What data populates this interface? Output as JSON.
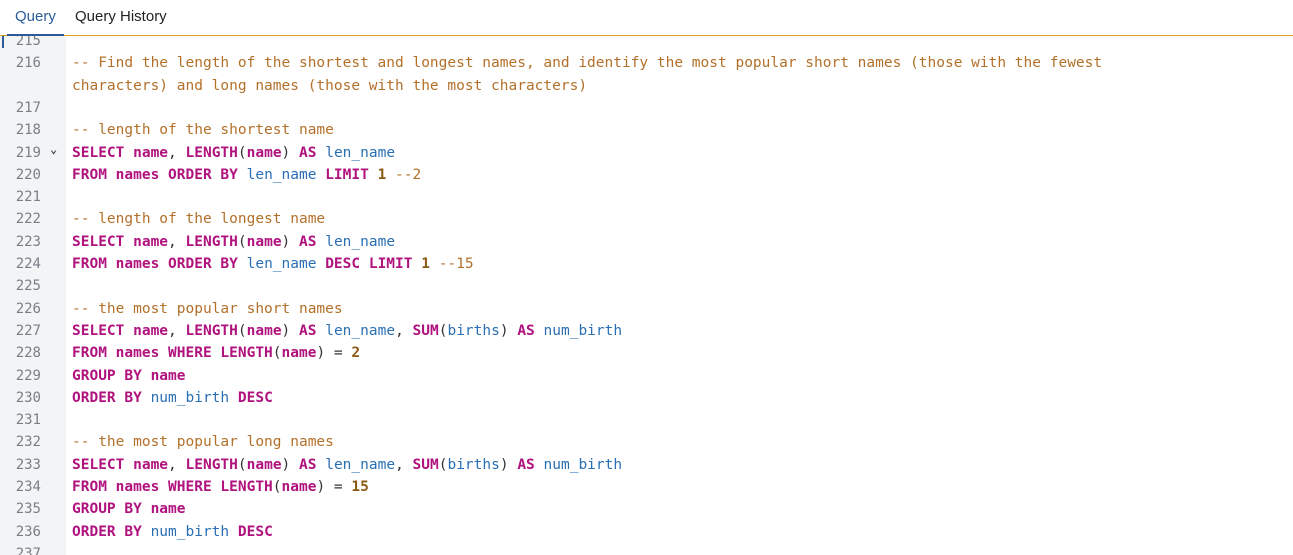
{
  "tabs": [
    {
      "label": "Query",
      "active": true
    },
    {
      "label": "Query History",
      "active": false
    }
  ],
  "colors": {
    "keyword": "#b0127e",
    "comment": "#b3702a",
    "identifier": "#2a6fb3",
    "number": "#8a5a12",
    "tab_active": "#2b5b9b",
    "divider": "#d6a21d"
  },
  "editor": {
    "fold_icon": "chevron-down-icon",
    "lines": [
      {
        "num": "215",
        "tokens": []
      },
      {
        "num": "216",
        "tokens": [
          {
            "t": "cm",
            "v": "-- Find the length of the shortest and longest names, and identify the most popular short names (those with the fewest"
          }
        ]
      },
      {
        "num": "",
        "tokens": [
          {
            "t": "cm",
            "v": "characters) and long names (those with the most characters)"
          }
        ]
      },
      {
        "num": "217",
        "tokens": []
      },
      {
        "num": "218",
        "tokens": [
          {
            "t": "cm",
            "v": "-- length of the shortest name"
          }
        ]
      },
      {
        "num": "219",
        "fold": true,
        "tokens": [
          {
            "t": "kw",
            "v": "SELECT name"
          },
          {
            "t": "tx",
            "v": ", "
          },
          {
            "t": "kw",
            "v": "LENGTH"
          },
          {
            "t": "tx",
            "v": "("
          },
          {
            "t": "kw",
            "v": "name"
          },
          {
            "t": "tx",
            "v": ") "
          },
          {
            "t": "kw",
            "v": "AS"
          },
          {
            "t": "tx",
            "v": " "
          },
          {
            "t": "id",
            "v": "len_name"
          }
        ]
      },
      {
        "num": "220",
        "tokens": [
          {
            "t": "kw",
            "v": "FROM names ORDER BY"
          },
          {
            "t": "tx",
            "v": " "
          },
          {
            "t": "id",
            "v": "len_name"
          },
          {
            "t": "tx",
            "v": " "
          },
          {
            "t": "kw",
            "v": "LIMIT"
          },
          {
            "t": "tx",
            "v": " "
          },
          {
            "t": "num",
            "v": "1"
          },
          {
            "t": "tx",
            "v": " "
          },
          {
            "t": "cm",
            "v": "--2"
          }
        ]
      },
      {
        "num": "221",
        "tokens": []
      },
      {
        "num": "222",
        "tokens": [
          {
            "t": "cm",
            "v": "-- length of the longest name"
          }
        ]
      },
      {
        "num": "223",
        "tokens": [
          {
            "t": "kw",
            "v": "SELECT name"
          },
          {
            "t": "tx",
            "v": ", "
          },
          {
            "t": "kw",
            "v": "LENGTH"
          },
          {
            "t": "tx",
            "v": "("
          },
          {
            "t": "kw",
            "v": "name"
          },
          {
            "t": "tx",
            "v": ") "
          },
          {
            "t": "kw",
            "v": "AS"
          },
          {
            "t": "tx",
            "v": " "
          },
          {
            "t": "id",
            "v": "len_name"
          }
        ]
      },
      {
        "num": "224",
        "tokens": [
          {
            "t": "kw",
            "v": "FROM names ORDER BY"
          },
          {
            "t": "tx",
            "v": " "
          },
          {
            "t": "id",
            "v": "len_name"
          },
          {
            "t": "tx",
            "v": " "
          },
          {
            "t": "kw",
            "v": "DESC LIMIT"
          },
          {
            "t": "tx",
            "v": " "
          },
          {
            "t": "num",
            "v": "1"
          },
          {
            "t": "tx",
            "v": " "
          },
          {
            "t": "cm",
            "v": "--15"
          }
        ]
      },
      {
        "num": "225",
        "tokens": []
      },
      {
        "num": "226",
        "tokens": [
          {
            "t": "cm",
            "v": "-- the most popular short names"
          }
        ]
      },
      {
        "num": "227",
        "tokens": [
          {
            "t": "kw",
            "v": "SELECT name"
          },
          {
            "t": "tx",
            "v": ", "
          },
          {
            "t": "kw",
            "v": "LENGTH"
          },
          {
            "t": "tx",
            "v": "("
          },
          {
            "t": "kw",
            "v": "name"
          },
          {
            "t": "tx",
            "v": ") "
          },
          {
            "t": "kw",
            "v": "AS"
          },
          {
            "t": "tx",
            "v": " "
          },
          {
            "t": "id",
            "v": "len_name"
          },
          {
            "t": "tx",
            "v": ", "
          },
          {
            "t": "kw",
            "v": "SUM"
          },
          {
            "t": "tx",
            "v": "("
          },
          {
            "t": "id",
            "v": "births"
          },
          {
            "t": "tx",
            "v": ") "
          },
          {
            "t": "kw",
            "v": "AS"
          },
          {
            "t": "tx",
            "v": " "
          },
          {
            "t": "id",
            "v": "num_birth"
          }
        ]
      },
      {
        "num": "228",
        "tokens": [
          {
            "t": "kw",
            "v": "FROM names WHERE LENGTH"
          },
          {
            "t": "tx",
            "v": "("
          },
          {
            "t": "kw",
            "v": "name"
          },
          {
            "t": "tx",
            "v": ") = "
          },
          {
            "t": "num",
            "v": "2"
          }
        ]
      },
      {
        "num": "229",
        "tokens": [
          {
            "t": "kw",
            "v": "GROUP BY name"
          }
        ]
      },
      {
        "num": "230",
        "tokens": [
          {
            "t": "kw",
            "v": "ORDER BY"
          },
          {
            "t": "tx",
            "v": " "
          },
          {
            "t": "id",
            "v": "num_birth"
          },
          {
            "t": "tx",
            "v": " "
          },
          {
            "t": "kw",
            "v": "DESC"
          }
        ]
      },
      {
        "num": "231",
        "tokens": []
      },
      {
        "num": "232",
        "tokens": [
          {
            "t": "cm",
            "v": "-- the most popular long names"
          }
        ]
      },
      {
        "num": "233",
        "tokens": [
          {
            "t": "kw",
            "v": "SELECT name"
          },
          {
            "t": "tx",
            "v": ", "
          },
          {
            "t": "kw",
            "v": "LENGTH"
          },
          {
            "t": "tx",
            "v": "("
          },
          {
            "t": "kw",
            "v": "name"
          },
          {
            "t": "tx",
            "v": ") "
          },
          {
            "t": "kw",
            "v": "AS"
          },
          {
            "t": "tx",
            "v": " "
          },
          {
            "t": "id",
            "v": "len_name"
          },
          {
            "t": "tx",
            "v": ", "
          },
          {
            "t": "kw",
            "v": "SUM"
          },
          {
            "t": "tx",
            "v": "("
          },
          {
            "t": "id",
            "v": "births"
          },
          {
            "t": "tx",
            "v": ") "
          },
          {
            "t": "kw",
            "v": "AS"
          },
          {
            "t": "tx",
            "v": " "
          },
          {
            "t": "id",
            "v": "num_birth"
          }
        ]
      },
      {
        "num": "234",
        "tokens": [
          {
            "t": "kw",
            "v": "FROM names WHERE LENGTH"
          },
          {
            "t": "tx",
            "v": "("
          },
          {
            "t": "kw",
            "v": "name"
          },
          {
            "t": "tx",
            "v": ") = "
          },
          {
            "t": "num",
            "v": "15"
          }
        ]
      },
      {
        "num": "235",
        "tokens": [
          {
            "t": "kw",
            "v": "GROUP BY name"
          }
        ]
      },
      {
        "num": "236",
        "tokens": [
          {
            "t": "kw",
            "v": "ORDER BY"
          },
          {
            "t": "tx",
            "v": " "
          },
          {
            "t": "id",
            "v": "num_birth"
          },
          {
            "t": "tx",
            "v": " "
          },
          {
            "t": "kw",
            "v": "DESC"
          }
        ]
      },
      {
        "num": "237",
        "tokens": []
      }
    ]
  }
}
